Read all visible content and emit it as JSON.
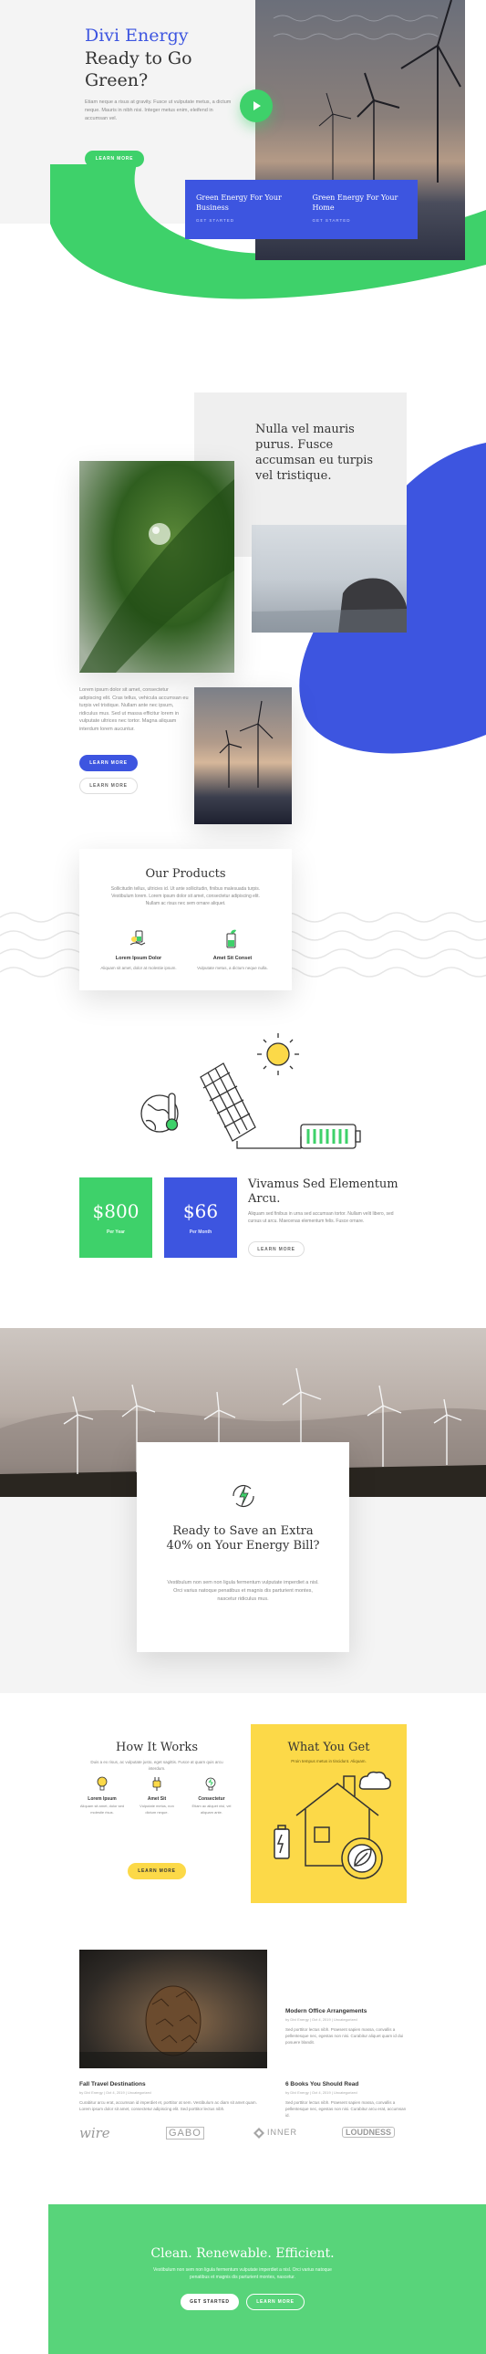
{
  "hero": {
    "brand": "Divi Energy",
    "heading": "Ready to Go Green?",
    "body": "Etiam neque a risus at gravity. Fusce ut vulputate metus, a dictum neque. Mauris in nibh nisi. Integer metus enim, eleifend in accumsan vel.",
    "button": "Learn More",
    "cards": [
      {
        "title": "Green Energy For Your Business",
        "link": "Get Started"
      },
      {
        "title": "Green Energy For Your Home",
        "link": "Get Started"
      }
    ]
  },
  "about": {
    "quote": "Nulla vel mauris purus. Fusce accumsan eu turpis vel tristique.",
    "body": "Lorem ipsum dolor sit amet, consectetur adipiscing elit. Cras tellus, vehicula accumsan eu turpis vel tristique. Nullam ante nec ipsum, ridiculus mus. Sed ut massa efficitur lorem in vulputate ultrices nec tortor. Magna aliquam interdum lorem aucuntur.",
    "primary_button": "Learn More",
    "secondary_button": "Learn More"
  },
  "products": {
    "title": "Our Products",
    "body": "Sollicitudin tellus, ultricies id. Ut ante sollicitudin, finibus malesuada turpis. Vestibulum lorem. Lorem ipsum dolor sit amet, consectetur adipiscing elit. Nullam ac risus nec sem ornare aliquet.",
    "items": [
      {
        "name": "Lorem Ipsum Dolor",
        "desc": "Aliquam sit amet, dolor at molestie ipsum."
      },
      {
        "name": "Amet Sit Conset",
        "desc": "Vulputate metus, a dictum neque nulla."
      }
    ]
  },
  "plans": {
    "prices": [
      {
        "amount": "$800",
        "label": "Per Year"
      },
      {
        "amount": "$66",
        "label": "Per Month"
      }
    ],
    "heading": "Vivamus Sed Elementum Arcu.",
    "body": "Aliquam sed finibus in urna sed accumsan tortor. Nullam velit libero, sed cursus ut arcu. Maecenas elementum felis. Fusce ornare.",
    "button": "Learn More"
  },
  "savings": {
    "heading": "Ready to Save an Extra 40% on Your Energy Bill?",
    "body": "Vestibulum non sem non ligula fermentum vulputate imperdiet a nisl. Orci varius natoque penatibus et magnis dis parturient montes, nascetur ridiculus mus."
  },
  "how": {
    "title": "How It Works",
    "subtitle": "Duis a ex risus, ac vulputate justo, eget sagittis. Fusce at quam quis arcu interdum.",
    "steps": [
      {
        "name": "Lorem Ipsum",
        "desc": "Aliquam sit amet, dolor sed molestie risus."
      },
      {
        "name": "Amet Sit",
        "desc": "Vulputate metus, non dictum neque."
      },
      {
        "name": "Consectetur",
        "desc": "Etiam ac aliquet nisl, vel aliquam ante."
      }
    ],
    "button": "Learn More"
  },
  "get": {
    "title": "What You Get",
    "subtitle": "Proin tempus metus in tincidunt. Aliquam."
  },
  "blog": {
    "posts": [
      {
        "title": "Fall Travel Destinations",
        "meta": "by Divi Energy | Oct 4, 2019 | Uncategorized",
        "excerpt": "Curabitur arcu erat, accumsan id imperdiet et, porttitor at sem. Vestibulum ac diam sit amet quam. Lorem ipsum dolor sit amet, consectetur adipiscing elit. Sed porttitor lectus nibh."
      },
      {
        "title": "Modern Office Arrangements",
        "meta": "by Divi Energy | Oct 4, 2019 | Uncategorized",
        "excerpt": "Sed porttitor lectus nibh. Praesent sapien massa, convallis a pellentesque nec, egestas non nisi. Curabitur aliquet quam id dui posuere blandit."
      },
      {
        "title": "6 Books You Should Read",
        "meta": "by Divi Energy | Oct 4, 2019 | Uncategorized",
        "excerpt": "Sed porttitor lectus nibh. Praesent sapien massa, convallis a pellentesque nec, egestas non nisi. Curabitur arcu erat, accumsan id."
      }
    ]
  },
  "logos": [
    "wire",
    "GABO",
    "INNER",
    "LOUDNESS"
  ],
  "footer": {
    "heading": "Clean. Renewable. Efficient.",
    "body": "Vestibulum non sem non ligula fermentum vulputate imperdiet a nisl. Orci varius natoque penatibus et magnis dis parturient montes, nascetur.",
    "primary_button": "Get Started",
    "secondary_button": "Learn More"
  },
  "colors": {
    "green": "#3ed16a",
    "blue": "#3d55e0",
    "yellow": "#fcd948",
    "dark": "#333333"
  }
}
